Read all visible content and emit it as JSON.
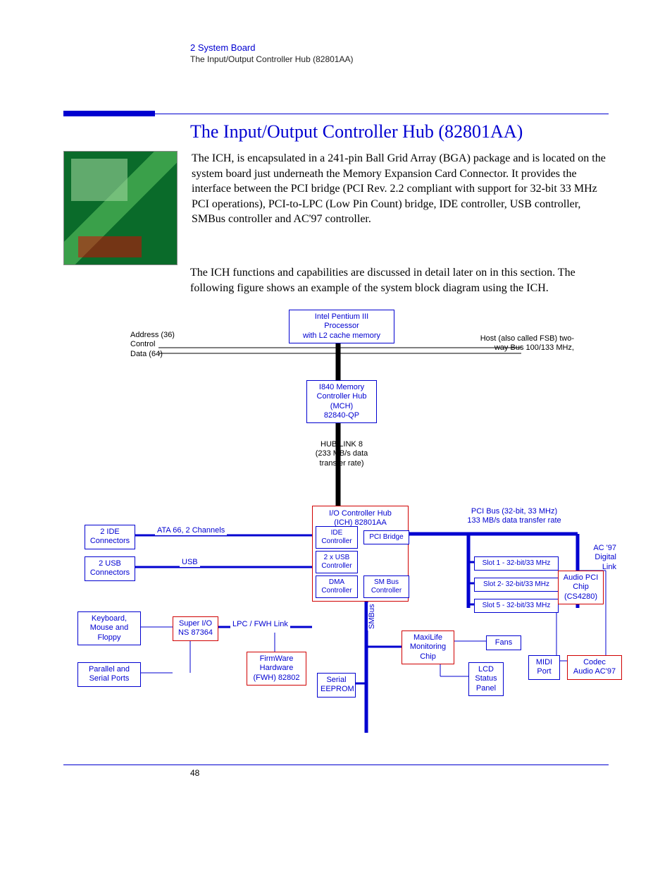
{
  "header": {
    "chapter": "2  System Board",
    "section": "The Input/Output Controller Hub (82801AA)"
  },
  "title": "The Input/Output Controller Hub (82801AA)",
  "para1": "The ICH, is encapsulated in a 241-pin Ball Grid Array (BGA) package and is located on the system board just underneath the Memory Expansion Card Connector. It provides the interface between the PCI bridge (PCI Rev. 2.2 compliant with support for 32-bit 33 MHz PCI operations), PCI-to-LPC (Low Pin Count) bridge, IDE controller, USB controller, SMBus controller and AC'97 controller.",
  "para2": "The ICH functions and capabilities are discussed in detail later on in this section. The following figure shows an example of the system block diagram using the ICH.",
  "diagram": {
    "cpu": "Intel Pentium III\nProcessor\nwith L2 cache memory",
    "addr": "Address (36)\nControl\nData (64)",
    "host": "Host (also called FSB) two-\nway Bus 100/133 MHz,",
    "mch": "I840 Memory\nController Hub\n(MCH)\n82840-QP",
    "hublink": "HUB LINK 8\n(233 MB/s data\ntransfer rate)",
    "ich": "I/O Controller Hub\n(ICH) 82801AA",
    "ide_ctrl": "IDE\nController",
    "pci_bridge": "PCI Bridge",
    "usb_ctrl": "2 x USB\nController",
    "dma_ctrl": "DMA\nController",
    "sm_ctrl": "SM Bus\nController",
    "ide_conn": "2 IDE\nConnectors",
    "usb_conn": "2 USB\nConnectors",
    "ata": "ATA 66, 2 Channels",
    "usb": "USB",
    "superio": "Super I/O\nNS 87364",
    "kbd": "Keyboard,\nMouse and\nFloppy",
    "ports": "Parallel and\nSerial Ports",
    "fwh": "FirmWare\nHardware\n(FWH) 82802",
    "lpc": "LPC / FWH Link",
    "eeprom": "Serial\nEEPROM",
    "smbus": "SMBus",
    "maxilife": "MaxiLife\nMonitoring\nChip",
    "fans": "Fans",
    "lcd": "LCD\nStatus\nPanel",
    "pci_bus": "PCI Bus (32-bit, 33 MHz)\n133 MB/s data transfer rate",
    "slot1": "Slot 1 - 32-bit/33 MHz",
    "slot2": "Slot 2- 32-bit/33 MHz",
    "slot5": "Slot 5 - 32-bit/33 MHz",
    "audio_pci": "Audio PCI\nChip\n(CS4280)",
    "ac97_link": "AC '97\nDigital\nLink",
    "midi": "MIDI\nPort",
    "codec": "Codec\nAudio AC'97"
  },
  "page_number": "48"
}
